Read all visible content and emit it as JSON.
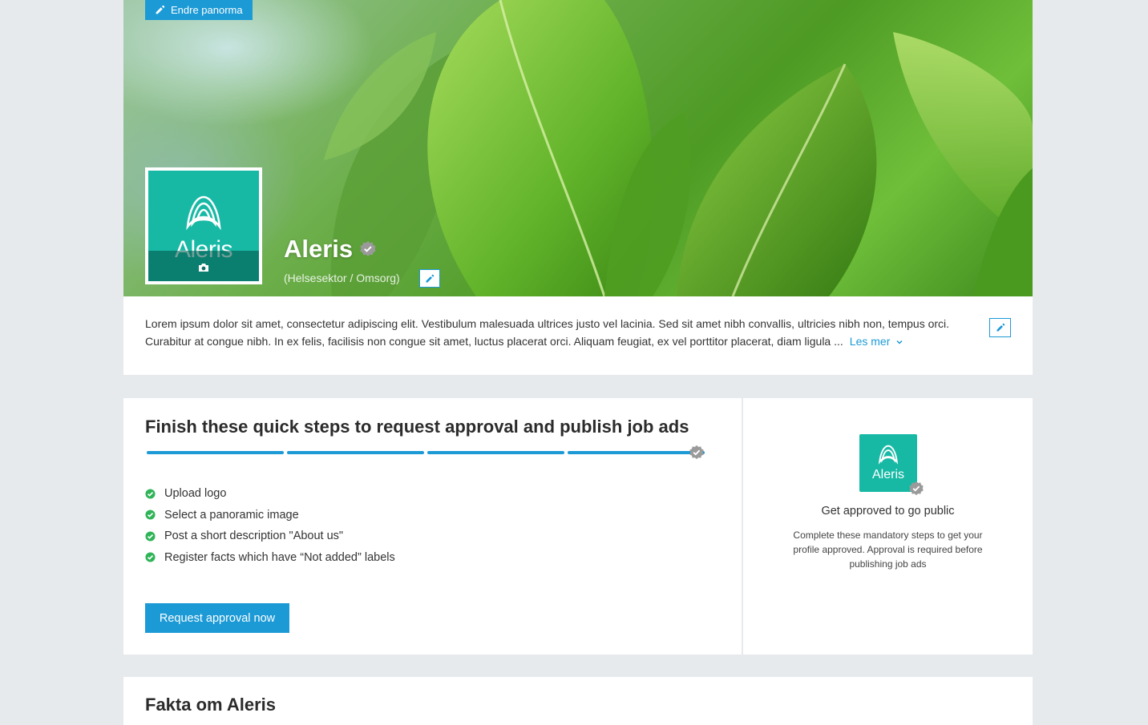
{
  "header": {
    "edit_panorama_label": "Endre panorma",
    "company_name": "Aleris",
    "company_sector": "(Helsesektor / Omsorg)",
    "logo_text": "Aleris"
  },
  "about": {
    "text": "Lorem ipsum dolor sit amet, consectetur adipiscing elit. Vestibulum malesuada ultrices justo vel lacinia. Sed sit amet nibh convallis, ultricies nibh non, tempus orci. Curabitur at congue nibh. In ex felis, facilisis non congue sit amet, luctus placerat orci. Aliquam feugiat, ex vel porttitor placerat, diam ligula ...",
    "read_more_label": "Les mer"
  },
  "steps": {
    "title": "Finish these quick steps to request approval and publish job ads",
    "progress_completed": 4,
    "progress_total": 4,
    "items": [
      {
        "label": "Upload logo",
        "done": true
      },
      {
        "label": "Select a panoramic image",
        "done": true
      },
      {
        "label": "Post a short description \"About us\"",
        "done": true
      },
      {
        "label": "Register facts which have “Not added” labels",
        "done": true
      }
    ],
    "request_button_label": "Request approval now"
  },
  "approval": {
    "logo_text": "Aleris",
    "title": "Get approved to go public",
    "description": "Complete these mandatory steps to get your profile approved. Approval is required before publishing job ads"
  },
  "facts": {
    "title": "Fakta om Aleris"
  },
  "colors": {
    "accent": "#1c9ad6",
    "brand_teal": "#17b9a5",
    "success_green": "#2fb457",
    "badge_gray": "#9a9a9a",
    "page_background": "#e6eaed"
  },
  "icons": {
    "edit": "pencil-icon",
    "camera": "camera-icon",
    "verified": "verified-badge-icon",
    "check": "check-circle-icon",
    "chevron": "chevron-down-icon"
  }
}
